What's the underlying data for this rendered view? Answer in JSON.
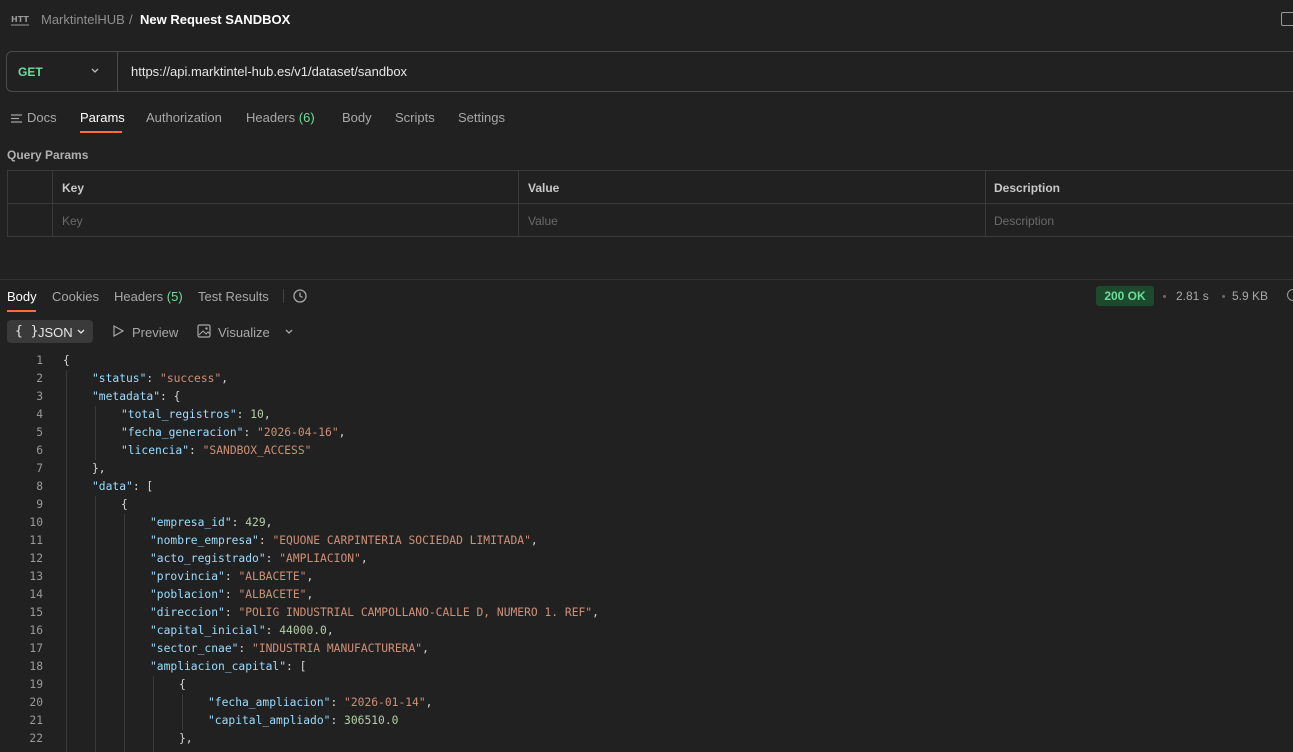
{
  "header": {
    "workspace": "MarktintelHUB",
    "separator": "/",
    "title": "New Request SANDBOX"
  },
  "request": {
    "method": "GET",
    "url": "https://api.marktintel-hub.es/v1/dataset/sandbox"
  },
  "request_tabs": {
    "docs": "Docs",
    "params": "Params",
    "authorization": "Authorization",
    "headers": "Headers",
    "headers_count": "(6)",
    "body": "Body",
    "scripts": "Scripts",
    "settings": "Settings"
  },
  "query_params": {
    "label": "Query Params",
    "columns": [
      "Key",
      "Value",
      "Description"
    ],
    "placeholders": [
      "Key",
      "Value",
      "Description"
    ]
  },
  "response_tabs": {
    "body": "Body",
    "cookies": "Cookies",
    "headers": "Headers",
    "headers_count": "(5)",
    "test_results": "Test Results"
  },
  "response_meta": {
    "status": "200 OK",
    "time": "2.81 s",
    "size": "5.9 KB"
  },
  "format_bar": {
    "brace": "{ }",
    "format": "JSON",
    "preview": "Preview",
    "visualize": "Visualize"
  },
  "code_lines": [
    {
      "n": "1",
      "indent": 0,
      "tokens": [
        {
          "t": "p",
          "v": "{"
        }
      ]
    },
    {
      "n": "2",
      "indent": 1,
      "tokens": [
        {
          "t": "k",
          "v": "\"status\""
        },
        {
          "t": "p",
          "v": ": "
        },
        {
          "t": "s",
          "v": "\"success\""
        },
        {
          "t": "p",
          "v": ","
        }
      ]
    },
    {
      "n": "3",
      "indent": 1,
      "tokens": [
        {
          "t": "k",
          "v": "\"metadata\""
        },
        {
          "t": "p",
          "v": ": {"
        }
      ]
    },
    {
      "n": "4",
      "indent": 2,
      "tokens": [
        {
          "t": "k",
          "v": "\"total_registros\""
        },
        {
          "t": "p",
          "v": ": "
        },
        {
          "t": "n",
          "v": "10"
        },
        {
          "t": "p",
          "v": ","
        }
      ]
    },
    {
      "n": "5",
      "indent": 2,
      "tokens": [
        {
          "t": "k",
          "v": "\"fecha_generacion\""
        },
        {
          "t": "p",
          "v": ": "
        },
        {
          "t": "s",
          "v": "\"2026-04-16\""
        },
        {
          "t": "p",
          "v": ","
        }
      ]
    },
    {
      "n": "6",
      "indent": 2,
      "tokens": [
        {
          "t": "k",
          "v": "\"licencia\""
        },
        {
          "t": "p",
          "v": ": "
        },
        {
          "t": "s",
          "v": "\"SANDBOX_ACCESS\""
        }
      ]
    },
    {
      "n": "7",
      "indent": 1,
      "tokens": [
        {
          "t": "p",
          "v": "},"
        }
      ]
    },
    {
      "n": "8",
      "indent": 1,
      "tokens": [
        {
          "t": "k",
          "v": "\"data\""
        },
        {
          "t": "p",
          "v": ": ["
        }
      ]
    },
    {
      "n": "9",
      "indent": 2,
      "tokens": [
        {
          "t": "p",
          "v": "{"
        }
      ]
    },
    {
      "n": "10",
      "indent": 3,
      "tokens": [
        {
          "t": "k",
          "v": "\"empresa_id\""
        },
        {
          "t": "p",
          "v": ": "
        },
        {
          "t": "n",
          "v": "429"
        },
        {
          "t": "p",
          "v": ","
        }
      ]
    },
    {
      "n": "11",
      "indent": 3,
      "tokens": [
        {
          "t": "k",
          "v": "\"nombre_empresa\""
        },
        {
          "t": "p",
          "v": ": "
        },
        {
          "t": "s",
          "v": "\"EQUONE CARPINTERIA SOCIEDAD LIMITADA\""
        },
        {
          "t": "p",
          "v": ","
        }
      ]
    },
    {
      "n": "12",
      "indent": 3,
      "tokens": [
        {
          "t": "k",
          "v": "\"acto_registrado\""
        },
        {
          "t": "p",
          "v": ": "
        },
        {
          "t": "s",
          "v": "\"AMPLIACION\""
        },
        {
          "t": "p",
          "v": ","
        }
      ]
    },
    {
      "n": "13",
      "indent": 3,
      "tokens": [
        {
          "t": "k",
          "v": "\"provincia\""
        },
        {
          "t": "p",
          "v": ": "
        },
        {
          "t": "s",
          "v": "\"ALBACETE\""
        },
        {
          "t": "p",
          "v": ","
        }
      ]
    },
    {
      "n": "14",
      "indent": 3,
      "tokens": [
        {
          "t": "k",
          "v": "\"poblacion\""
        },
        {
          "t": "p",
          "v": ": "
        },
        {
          "t": "s",
          "v": "\"ALBACETE\""
        },
        {
          "t": "p",
          "v": ","
        }
      ]
    },
    {
      "n": "15",
      "indent": 3,
      "tokens": [
        {
          "t": "k",
          "v": "\"direccion\""
        },
        {
          "t": "p",
          "v": ": "
        },
        {
          "t": "s",
          "v": "\"POLIG INDUSTRIAL CAMPOLLANO-CALLE D, NUMERO 1. REF\""
        },
        {
          "t": "p",
          "v": ","
        }
      ]
    },
    {
      "n": "16",
      "indent": 3,
      "tokens": [
        {
          "t": "k",
          "v": "\"capital_inicial\""
        },
        {
          "t": "p",
          "v": ": "
        },
        {
          "t": "n",
          "v": "44000.0"
        },
        {
          "t": "p",
          "v": ","
        }
      ]
    },
    {
      "n": "17",
      "indent": 3,
      "tokens": [
        {
          "t": "k",
          "v": "\"sector_cnae\""
        },
        {
          "t": "p",
          "v": ": "
        },
        {
          "t": "s",
          "v": "\"INDUSTRIA MANUFACTURERA\""
        },
        {
          "t": "p",
          "v": ","
        }
      ]
    },
    {
      "n": "18",
      "indent": 3,
      "tokens": [
        {
          "t": "k",
          "v": "\"ampliacion_capital\""
        },
        {
          "t": "p",
          "v": ": ["
        }
      ]
    },
    {
      "n": "19",
      "indent": 4,
      "tokens": [
        {
          "t": "p",
          "v": "{"
        }
      ]
    },
    {
      "n": "20",
      "indent": 5,
      "tokens": [
        {
          "t": "k",
          "v": "\"fecha_ampliacion\""
        },
        {
          "t": "p",
          "v": ": "
        },
        {
          "t": "s",
          "v": "\"2026-01-14\""
        },
        {
          "t": "p",
          "v": ","
        }
      ]
    },
    {
      "n": "21",
      "indent": 5,
      "tokens": [
        {
          "t": "k",
          "v": "\"capital_ampliado\""
        },
        {
          "t": "p",
          "v": ": "
        },
        {
          "t": "n",
          "v": "306510.0"
        }
      ]
    },
    {
      "n": "22",
      "indent": 4,
      "tokens": [
        {
          "t": "p",
          "v": "},"
        }
      ]
    }
  ],
  "colors": {
    "accent": "#ff6c37",
    "method_get": "#6bdd9a",
    "json_key": "#9cdcfe",
    "json_string": "#ce9178",
    "json_number": "#b5cea8"
  }
}
